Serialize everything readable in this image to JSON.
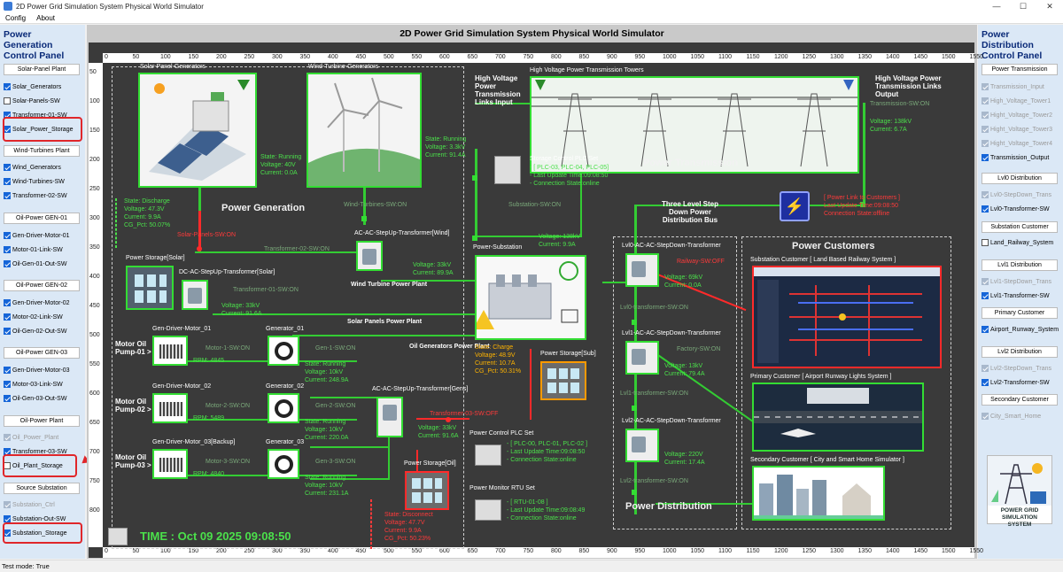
{
  "window": {
    "title": "2D Power Grid Simulation System Physical World Simulator",
    "controls": [
      "—",
      "☐",
      "✕"
    ]
  },
  "menu": [
    "Config",
    "About"
  ],
  "status": "Test mode: True",
  "left_panel": {
    "title": "Power Generation Control Panel",
    "sections": [
      {
        "header": "Solar-Panel Plant",
        "items": [
          {
            "label": "Solar_Generators",
            "checked": true
          },
          {
            "label": "Solar-Panels-SW",
            "checked": false
          },
          {
            "label": "Transformer-01-SW",
            "checked": true
          },
          {
            "label": "Solar_Power_Storage",
            "checked": true
          }
        ]
      },
      {
        "header": "Wind-Turbines Plant",
        "items": [
          {
            "label": "Wind_Generators",
            "checked": true
          },
          {
            "label": "Wind-Turbines-SW",
            "checked": true
          },
          {
            "label": "Transformer-02-SW",
            "checked": true
          }
        ]
      },
      {
        "header": "Oil-Power GEN-01",
        "items": [
          {
            "label": "Gen-Driver-Motor-01",
            "checked": true
          },
          {
            "label": "Motor-01-Link-SW",
            "checked": true
          },
          {
            "label": "Oil-Gen-01-Out-SW",
            "checked": true
          }
        ]
      },
      {
        "header": "Oil-Power GEN-02",
        "items": [
          {
            "label": "Gen-Driver-Motor-02",
            "checked": true
          },
          {
            "label": "Motor-02-Link-SW",
            "checked": true
          },
          {
            "label": "Oil-Gen-02-Out-SW",
            "checked": true
          }
        ]
      },
      {
        "header": "Oil-Power GEN-03",
        "items": [
          {
            "label": "Gen-Driver-Motor-03",
            "checked": true
          },
          {
            "label": "Motor-03-Link-SW",
            "checked": true
          },
          {
            "label": "Oil-Gen-03-Out-SW",
            "checked": true
          }
        ]
      },
      {
        "header": "Oil-Power Plant",
        "items": [
          {
            "label": "Oil_Power_Plant",
            "checked": true,
            "disabled": true
          },
          {
            "label": "Transformer-03-SW",
            "checked": true
          },
          {
            "label": "Oil_Plant_Storage",
            "checked": false
          }
        ]
      },
      {
        "header": "Source Substation",
        "items": [
          {
            "label": "Substation_Ctrl",
            "checked": true,
            "disabled": true
          },
          {
            "label": "Substation-Out-SW",
            "checked": true
          },
          {
            "label": "Substation_Storage",
            "checked": true
          }
        ]
      }
    ]
  },
  "right_panel": {
    "title": "Power Distribution Control Panel",
    "sections": [
      {
        "header": "Power Transmission",
        "items": [
          {
            "label": "Transmission_Input",
            "checked": true,
            "disabled": true
          },
          {
            "label": "High_Voltage_Tower1",
            "checked": true,
            "disabled": true
          },
          {
            "label": "Hight_Voltage_Tower2",
            "checked": true,
            "disabled": true
          },
          {
            "label": "Hight_Voltage_Tower3",
            "checked": true,
            "disabled": true
          },
          {
            "label": "Hight_Voltage_Tower4",
            "checked": true,
            "disabled": true
          },
          {
            "label": "Transmission_Output",
            "checked": true
          }
        ]
      },
      {
        "header": "Lvl0 Distribution",
        "items": [
          {
            "label": "Lvl0-StepDown_Trans",
            "checked": true,
            "disabled": true
          },
          {
            "label": "Lvl0-Transformer-SW",
            "checked": true
          }
        ]
      },
      {
        "header": "Substation Customer",
        "items": [
          {
            "label": "Land_Railway_System",
            "checked": false
          }
        ]
      },
      {
        "header": "Lvl1 Distribution",
        "items": [
          {
            "label": "Lvl1-StepDown_Trans",
            "checked": true,
            "disabled": true
          },
          {
            "label": "Lvl1-Transformer-SW",
            "checked": true
          }
        ]
      },
      {
        "header": "Primary Customer",
        "items": [
          {
            "label": "Airport_Runway_System",
            "checked": true
          }
        ]
      },
      {
        "header": "Lvl2 Distribution",
        "items": [
          {
            "label": "Lvl2-StepDown_Trans",
            "checked": true,
            "disabled": true
          },
          {
            "label": "Lvl2-Transformer-SW",
            "checked": true
          }
        ]
      },
      {
        "header": "Secondary Customer",
        "items": [
          {
            "label": "City_Smart_Home",
            "checked": true,
            "disabled": true
          }
        ]
      }
    ],
    "logo_text": "POWER GRID SIMULATION SYSTEM"
  },
  "sim": {
    "title": "2D Power Grid Simulation System Physical World Simulator",
    "ruler_x": [
      "0",
      "50",
      "100",
      "150",
      "200",
      "250",
      "300",
      "350",
      "400",
      "450",
      "500",
      "550",
      "600",
      "650",
      "700",
      "750",
      "800",
      "850",
      "900",
      "950",
      "1000",
      "1050",
      "1100",
      "1150",
      "1200",
      "1250",
      "1300",
      "1350",
      "1400",
      "1450",
      "1500",
      "1550"
    ],
    "ruler_y": [
      "50",
      "100",
      "150",
      "200",
      "250",
      "300",
      "350",
      "400",
      "450",
      "500",
      "550",
      "600",
      "650",
      "700",
      "750",
      "800"
    ],
    "solar_gen": {
      "name": "Solar-Panel-Generators",
      "state": "State: Running",
      "voltage": "Voltage: 40V",
      "current": "Current: 0.0A"
    },
    "wind_gen": {
      "name": "Wind-Turbine-Generators",
      "state": "State: Running",
      "voltage": "Voltage: 3.3kV",
      "current": "Current: 91.4A"
    },
    "power_generation": "Power Generation",
    "solar_storage": {
      "name": "Power Storage[Solar]",
      "state": "State: Discharge",
      "voltage": "Voltage: 47.3V",
      "current": "Current: 9.9A",
      "pct": "CG_Pct: 50.07%"
    },
    "solar_panels_sw": "Solar-Panels-SW:ON",
    "wind_turbines_sw": "Wind-Turbines-SW:ON",
    "transformer_02_sw": "Transformer-02-SW:ON",
    "transformer_01_sw": "Transformer-01-SW:ON",
    "wind_xfmr": {
      "name": "AC-AC-StepUp-Transformer[Wind]",
      "voltage": "Voltage: 33kV",
      "current": "Current: 89.9A"
    },
    "solar_xfmr": {
      "name": "DC-AC-StepUp-Transformer[Solar]",
      "voltage": "Voltage: 33kV",
      "current": "Current: 91.6A"
    },
    "wind_plant": "Wind Turbine Power Plant",
    "solar_plant": "Solar Panels Power Plant",
    "motors": [
      {
        "name": "Gen-Driver-Motor_01",
        "pump": "Motor Oil Pump-01 >",
        "rpm": "RPM: 4845",
        "link_sw": "Motor-1-SW:ON",
        "gen": "Generator_01",
        "gen_sw": "Gen-1-SW:ON",
        "state": "State: Running",
        "voltage": "Voltage: 10kV",
        "current": "Current: 248.9A"
      },
      {
        "name": "Gen-Driver-Motor_02",
        "pump": "Motor Oil Pump-02 >",
        "rpm": "RPM: 5489",
        "link_sw": "Motor-2-SW:ON",
        "gen": "Generator_02",
        "gen_sw": "Gen-2-SW:ON",
        "state": "State: Running",
        "voltage": "Voltage: 10kV",
        "current": "Current: 220.0A"
      },
      {
        "name": "Gen-Driver-Motor_03[Backup]",
        "pump": "Motor Oil Pump-03 >",
        "rpm": "RPM: 4840",
        "link_sw": "Motor-3-SW:ON",
        "gen": "Generator_03",
        "gen_sw": "Gen-3-SW:ON",
        "state": "State: Running",
        "voltage": "Voltage: 10kV",
        "current": "Current: 231.1A"
      }
    ],
    "oil_plant": "Oil Generators Power Plant",
    "gens_xfmr": {
      "name": "AC-AC-StepUp-Transformer[Gens]",
      "voltage": "Voltage: 33kV",
      "current": "Current: 91.6A"
    },
    "transformer_03_sw": "Transformer-03-SW:OFF",
    "oil_storage": {
      "name": "Power Storage[Oil]",
      "state": "State: Disconnect",
      "voltage": "Voltage: 47.7V",
      "current": "Current: 9.9A",
      "pct": "CG_Pct: 50.23%"
    },
    "time": "TIME : Oct 09 2025 09:08:50",
    "substation": {
      "name": "Power-Substation",
      "state": "State: Charge",
      "voltage": "Voltage: 48.9V",
      "current": "Current: 10.7A",
      "pct": "CG_Pct: 50.31%",
      "out_voltage": "Voltage: 138kV",
      "out_current": "Current: 9.9A"
    },
    "sub_storage": "Power Storage[Sub]",
    "substation_sw": "Substation-SW:ON",
    "storage_plc": {
      "title": "Storage Control PLC Set",
      "ids": "- [ PLC-03, PLC-04, PLC-05]",
      "update": "- Last Update Time:09:08:50",
      "conn": "- Connection State:online"
    },
    "power_plc": {
      "title": "Power Control PLC Set",
      "ids": "- [ PLC-00, PLC-01, PLC-02 ]",
      "update": "- Last Update Time:09:08:50",
      "conn": "- Connection State:online"
    },
    "rtu": {
      "title": "Power Monitor RTU Set",
      "ids": "- [ RTU-01-08 ]",
      "update": "- Last Update Time:09:08:49",
      "conn": "- Connection State:online"
    },
    "hv_input": "High Voltage Power Transmission Links Input",
    "hv_output": "High Voltage Power Transmission Links Output",
    "towers": "High Voltage Power Transmission Towers",
    "transmission": "Power Transmission",
    "transmission_sw": "Transmission-SW:ON",
    "trans_out": {
      "voltage": "Voltage: 138kV",
      "current": "Current: 6.7A"
    },
    "three_level": "Three Level Step Down Power Distribution Bus",
    "power_link": {
      "state": "[ Power Link to Customers ]",
      "update": "Last Update Time:09:08:50",
      "conn": "Connection State:offline"
    },
    "lvl0": {
      "name": "Lvl0-AC-AC-StepDown-Transformer",
      "voltage": "Voltage: 69kV",
      "current": "Current: 0.0A",
      "sw": "Lvl0-transformer-SW:ON",
      "railway_sw": "Railway-SW:OFF"
    },
    "lvl1": {
      "name": "Lvl1-AC-AC-StepDown-Transformer",
      "voltage": "Voltage: 13kV",
      "current": "Current: 79.4A",
      "sw": "Lvl1-transformer-SW:ON",
      "factory_sw": "Factory-SW:ON"
    },
    "lvl2": {
      "name": "Lvl2-AC-AC-StepDown-Transformer",
      "voltage": "Voltage: 220V",
      "current": "Current: 17.4A",
      "sw": "Lvl2-transformer-SW:ON"
    },
    "power_distribution": "Power Distribution",
    "power_customers": "Power Customers",
    "cust_sub": "Substation Customer [ Land Based Railway System ]",
    "cust_primary": "Primary Customer [ Airport Runway Lights System ]",
    "cust_secondary": "Secondary Customer [ City and Smart Home Simulator ]"
  }
}
